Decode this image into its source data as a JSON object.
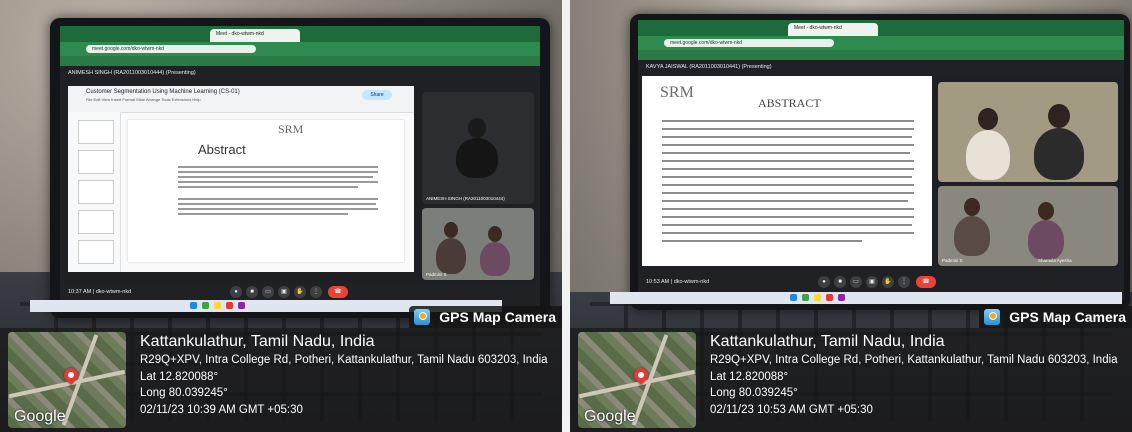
{
  "gps_badge_label": "GPS Map Camera",
  "photos": [
    {
      "city": "Kattankulathur, Tamil Nadu, India",
      "address": "R29Q+XPV, Intra College Rd, Potheri, Kattankulathur, Tamil Nadu 603203, India",
      "lat": "Lat 12.820088°",
      "long": "Long 80.039245°",
      "datetime": "02/11/23 10:39 AM GMT +05:30",
      "map_brand": "Google",
      "screen": {
        "tab_title": "Meet - dko-wtwm-nkd",
        "url": "meet.google.com/dko-wtwm-nkd",
        "presenting_label": "ANIMESH SINGH (RA2011003010444) (Presenting)",
        "doc_title": "Customer Segmentation Using Machine Learning (CS-01)",
        "doc_menu": "File  Edit  View  Insert  Format  Slide  Arrange  Tools  Extensions  Help",
        "share_label": "Share",
        "slide_heading": "Abstract",
        "slide_logo": "SRM",
        "tile_names": [
          "ANIMESH SINGH (RA2011003010444)",
          "Padmini S"
        ],
        "clock": "10:37 AM | dko-wtwm-nkd"
      }
    },
    {
      "city": "Kattankulathur, Tamil Nadu, India",
      "address": "R29Q+XPV, Intra College Rd, Potheri, Kattankulathur, Tamil Nadu 603203, India",
      "lat": "Lat 12.820088°",
      "long": "Long 80.039245°",
      "datetime": "02/11/23 10:53 AM GMT +05:30",
      "map_brand": "Google",
      "screen": {
        "tab_title": "Meet - dko-wtwm-nkd",
        "url": "meet.google.com/dko-wtwm-nkd",
        "presenting_label": "KAVYA JAISWAL (RA2011003010441) (Presenting)",
        "slide_logo": "SRM",
        "slide_heading": "ABSTRACT",
        "tile_names": [
          "Padmini S",
          "Sharmila Ayesha"
        ],
        "clock": "10:53 AM | dko-wtwm-nkd"
      }
    }
  ]
}
